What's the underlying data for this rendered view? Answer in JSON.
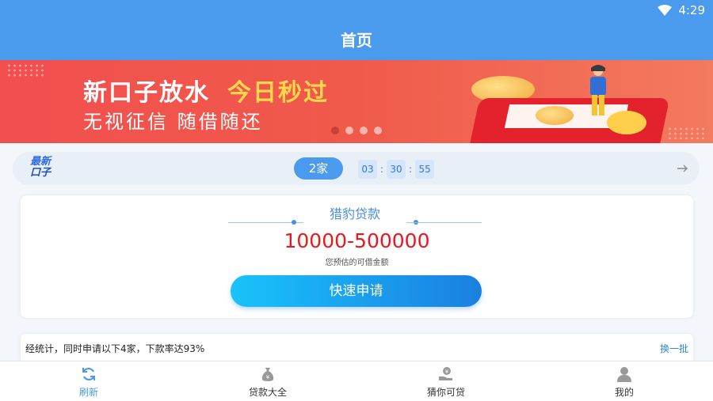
{
  "status_bar": {
    "time": "4:29",
    "wifi_icon": "wifi-icon"
  },
  "app_bar": {
    "title": "首页"
  },
  "banner": {
    "title_main": "新口子放水",
    "title_highlight": "今日秒过",
    "subtitle": "无视征信  随借随还",
    "active_slide": 1,
    "slide_count": 4
  },
  "new_bar": {
    "logo_line1": "最新",
    "logo_line2": "口子",
    "count_badge": "2家",
    "timer": {
      "hours": "03",
      "minutes": "30",
      "seconds": "55",
      "sep": ":"
    },
    "arrow_icon": "arrow-right-icon"
  },
  "loan_card": {
    "title": "猎豹贷款",
    "amount": "10000-500000",
    "amount_caption": "您预估的可借金额",
    "apply_label": "快速申请"
  },
  "stats": {
    "text": "经统计，同时申请以下4家，下款率达93%",
    "link": "换一批"
  },
  "tabbar": {
    "items": [
      {
        "label": "刷新",
        "icon": "refresh-icon",
        "active": true
      },
      {
        "label": "贷款大全",
        "icon": "money-bag-icon",
        "active": false
      },
      {
        "label": "猜你可贷",
        "icon": "hand-coin-icon",
        "active": false
      },
      {
        "label": "我的",
        "icon": "user-icon",
        "active": false
      }
    ]
  },
  "colors": {
    "primary": "#4a9aee",
    "amount_red": "#e8181e",
    "highlight_yellow": "#ffd84a"
  }
}
